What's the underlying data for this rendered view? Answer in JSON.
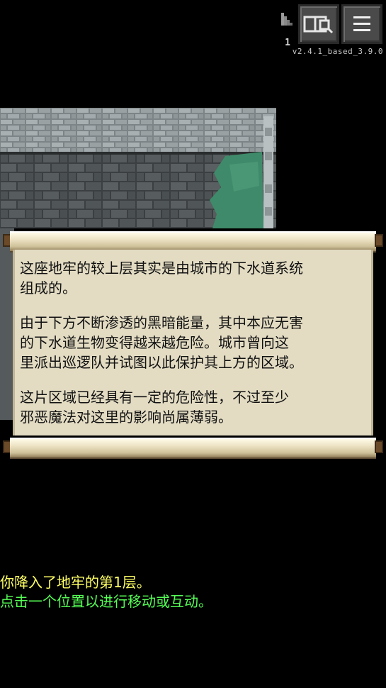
{
  "hud": {
    "depth": "1",
    "version": "v2.4.1_based_3.9.0",
    "journal_icon": "journal-search-icon",
    "menu_icon": "menu-icon",
    "depth_icon": "stairs-icon"
  },
  "story": {
    "paragraphs": [
      "这座地牢的较上层其实是由城市的下水道系统\n组成的。",
      "由于下方不断渗透的黑暗能量，其中本应无害\n的下水道生物变得越来越危险。城市曾向这\n里派出巡逻队并试图以此保护其上方的区域。",
      "这片区域已经具有一定的危险性，不过至少\n邪恶魔法对这里的影响尚属薄弱。"
    ]
  },
  "log": {
    "line1": "你降入了地牢的第1层。",
    "line2": "点击一个位置以进行移动或互动。"
  },
  "colors": {
    "log_info": "#ffff66",
    "log_hint": "#55ff55",
    "parchment": "#e3dcc3",
    "water": "#3f8a6a"
  }
}
